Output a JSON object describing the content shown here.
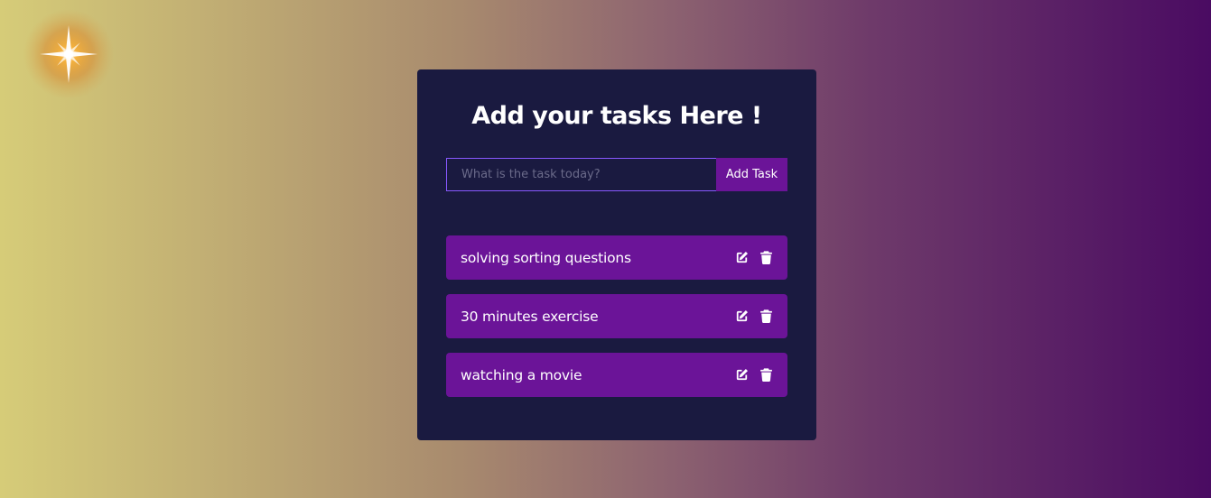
{
  "colors": {
    "card_background": "#1a1a40",
    "accent": "#6b1498",
    "input_border": "#8758ff",
    "text": "#ffffff"
  },
  "header": {
    "title": "Add your tasks Here !"
  },
  "form": {
    "placeholder": "What is the task today?",
    "value": "",
    "add_label": "Add Task"
  },
  "todos": [
    {
      "text": "solving sorting questions",
      "edit_icon": "edit-icon",
      "delete_icon": "trash-icon"
    },
    {
      "text": "30 minutes exercise",
      "edit_icon": "edit-icon",
      "delete_icon": "trash-icon"
    },
    {
      "text": "watching a movie",
      "edit_icon": "edit-icon",
      "delete_icon": "trash-icon"
    }
  ]
}
